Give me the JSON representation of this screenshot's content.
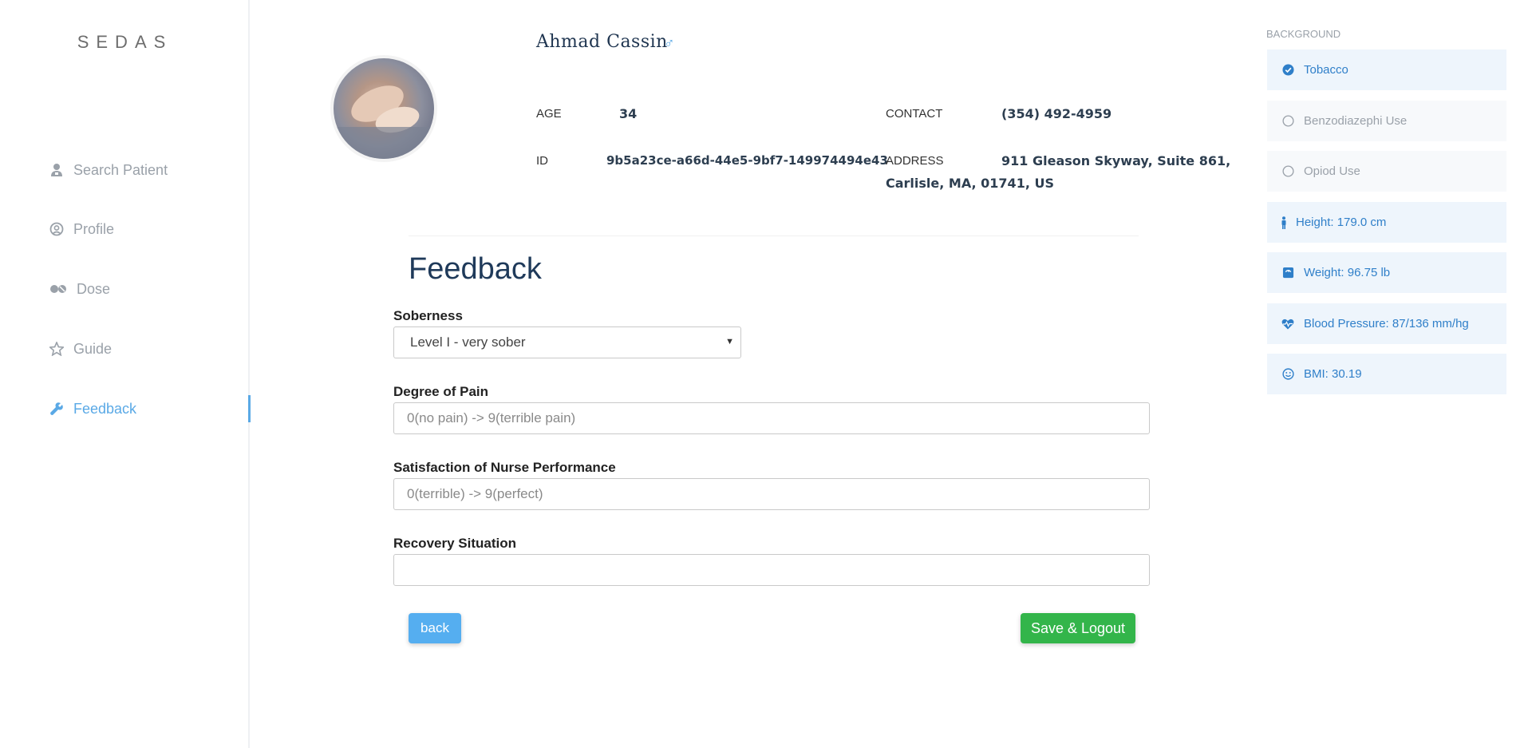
{
  "brand": "SEDAS",
  "nav": [
    {
      "label": "Search Patient",
      "icon": "user-doctor-icon"
    },
    {
      "label": "Profile",
      "icon": "user-circle-icon"
    },
    {
      "label": "Dose",
      "icon": "pills-icon"
    },
    {
      "label": "Guide",
      "icon": "star-icon"
    },
    {
      "label": "Feedback",
      "icon": "wrench-icon",
      "active": true
    }
  ],
  "patient": {
    "name": "Ahmad Cassin",
    "gender_icon": "male-icon",
    "age_label": "AGE",
    "age": "34",
    "id_label": "ID",
    "id": "9b5a23ce-a66d-44e5-9bf7-149974494e43",
    "contact_label": "CONTACT",
    "contact": "(354) 492-4959",
    "address_label": "ADDRESS",
    "address_line1": "911 Gleason Skyway, Suite 861,",
    "address_line2": "Carlisle, MA, 01741, US"
  },
  "form": {
    "title": "Feedback",
    "soberness_label": "Soberness",
    "soberness_value": "Level I - very sober",
    "pain_label": "Degree of Pain",
    "pain_placeholder": "0(no pain) -> 9(terrible pain)",
    "nurse_label": "Satisfaction of Nurse Performance",
    "nurse_placeholder": "0(terrible) -> 9(perfect)",
    "recovery_label": "Recovery Situation",
    "recovery_placeholder": "",
    "back_label": "back",
    "save_label": "Save & Logout"
  },
  "background": {
    "title": "BACKGROUND",
    "items": [
      {
        "label": "Tobacco",
        "icon": "check-circle-icon",
        "checked": true
      },
      {
        "label": "Benzodiazephi Use",
        "icon": "circle-icon",
        "checked": false
      },
      {
        "label": "Opiod Use",
        "icon": "circle-icon",
        "checked": false
      }
    ],
    "stats": [
      {
        "label": "Height: 179.0 cm",
        "icon": "person-icon"
      },
      {
        "label": "Weight: 96.75 lb",
        "icon": "scale-icon"
      },
      {
        "label": "Blood Pressure: 87/136 mm/hg",
        "icon": "heartbeat-icon"
      },
      {
        "label": "BMI: 30.19",
        "icon": "smile-icon"
      }
    ]
  },
  "colors": {
    "accent": "#5aa9e6",
    "save": "#33b54a",
    "back": "#55aef0",
    "card": "#eef5fc"
  }
}
